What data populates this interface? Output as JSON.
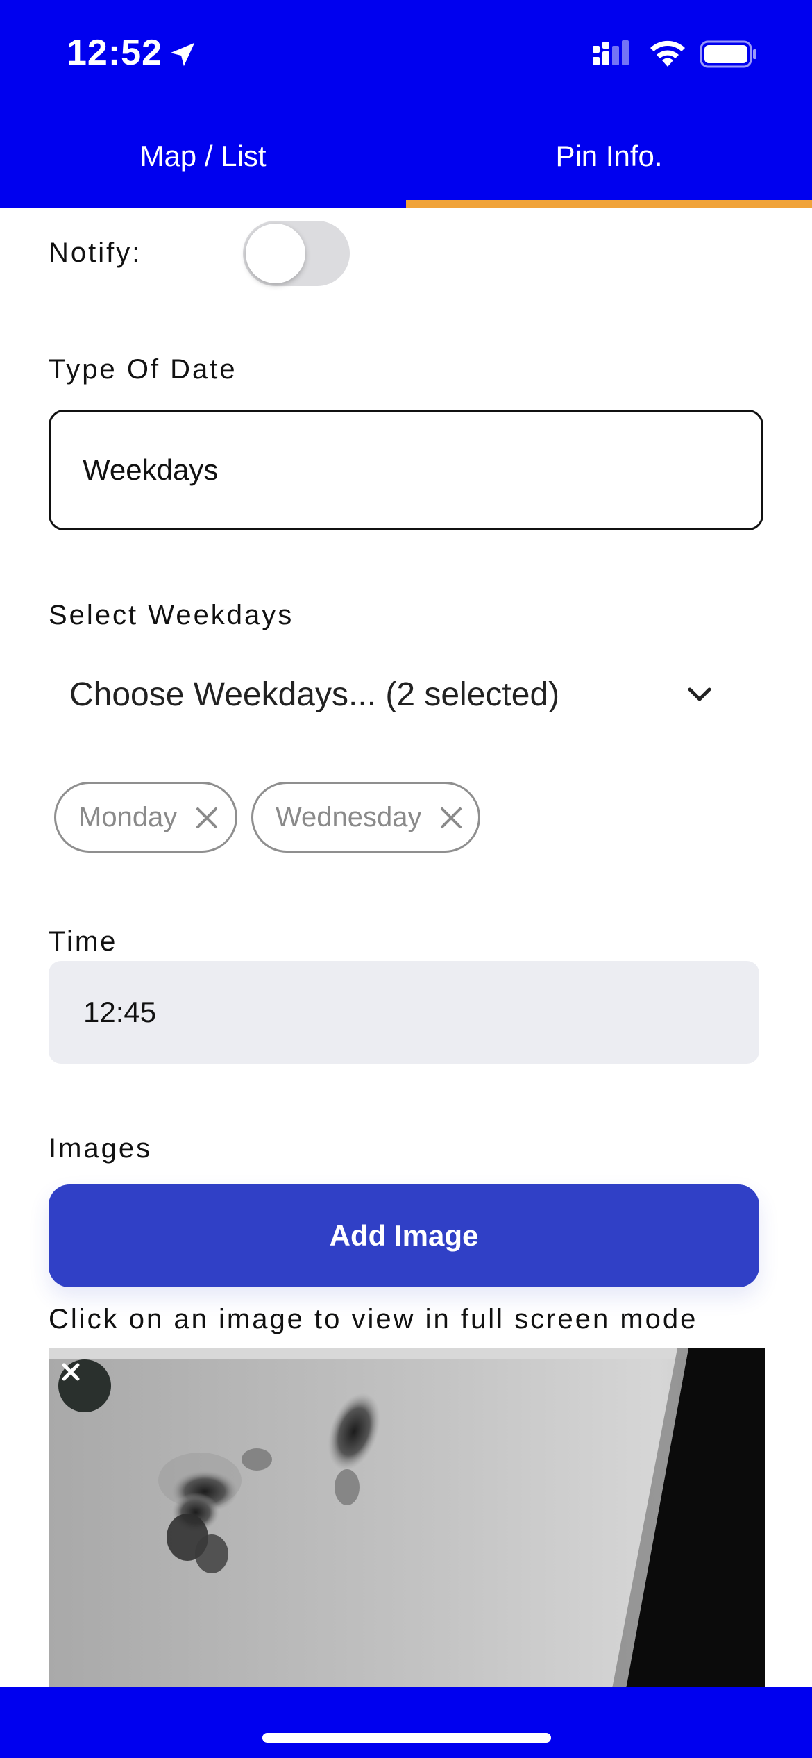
{
  "status_bar": {
    "time": "12:52",
    "icons": [
      "location-arrow-icon",
      "cellular-signal-icon",
      "wifi-icon",
      "battery-icon"
    ]
  },
  "tabs": [
    {
      "label": "Map / List",
      "active": false
    },
    {
      "label": "Pin Info.",
      "active": true
    }
  ],
  "form": {
    "notify_label": "Notify:",
    "notify_on": false,
    "date_type_label": "Type Of Date",
    "date_type_value": "Weekdays",
    "weekdays_label": "Select Weekdays",
    "weekdays_select_text": "Choose Weekdays... (2 selected)",
    "selected_weekdays": [
      "Monday",
      "Wednesday"
    ],
    "time_label": "Time",
    "time_value": "12:45",
    "images_label": "Images",
    "add_image_label": "Add Image",
    "images_hint": "Click on an image to view in full screen mode"
  },
  "colors": {
    "header_bg": "#0000ef",
    "tab_indicator": "#f0a33a",
    "add_button": "#3040c6",
    "time_field_bg": "#ecedf2"
  }
}
